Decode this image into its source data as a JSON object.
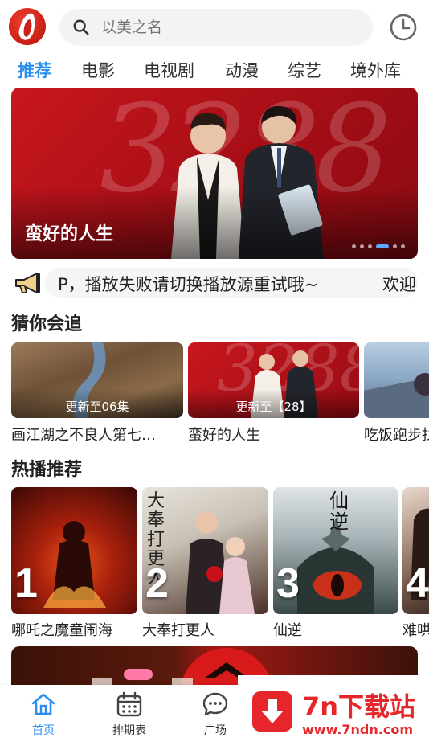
{
  "header": {
    "search_placeholder": "以美之名"
  },
  "tabs": [
    {
      "label": "推荐",
      "active": true
    },
    {
      "label": "电影"
    },
    {
      "label": "电视剧"
    },
    {
      "label": "动漫"
    },
    {
      "label": "综艺"
    },
    {
      "label": "境外库"
    }
  ],
  "banner": {
    "title": "蛮好的人生",
    "poster_text": "3288",
    "slide_count": 6,
    "active_slide": 4
  },
  "notice": {
    "text": "P，播放失败请切换播放源重试哦~",
    "text_next": "欢迎"
  },
  "guess_section": {
    "title": "猜你会追",
    "items": [
      {
        "title": "画江湖之不良人第七…",
        "episode": "更新至06集"
      },
      {
        "title": "蛮好的人生",
        "episode": "更新至【28】"
      },
      {
        "title": "吃饭跑步找"
      }
    ]
  },
  "hot_section": {
    "title": "热播推荐",
    "items": [
      {
        "rank": "1",
        "title": "哪吒之魔童闹海"
      },
      {
        "rank": "2",
        "title": "大奉打更人",
        "poster_text": "大奉打更人"
      },
      {
        "rank": "3",
        "title": "仙逆",
        "poster_text": "仙逆"
      },
      {
        "rank": "4",
        "title": "难哄"
      }
    ]
  },
  "tabbar": [
    {
      "label": "首页",
      "icon": "home-icon",
      "active": true
    },
    {
      "label": "排期表",
      "icon": "calendar-icon"
    },
    {
      "label": "广场",
      "icon": "chat-icon"
    }
  ],
  "watermark": {
    "title": "7n下载站",
    "url": "www.7ndn.com"
  },
  "colors": {
    "accent": "#2a8ef0",
    "banner_red": "#c8161e",
    "watermark_red": "#e7262b"
  }
}
